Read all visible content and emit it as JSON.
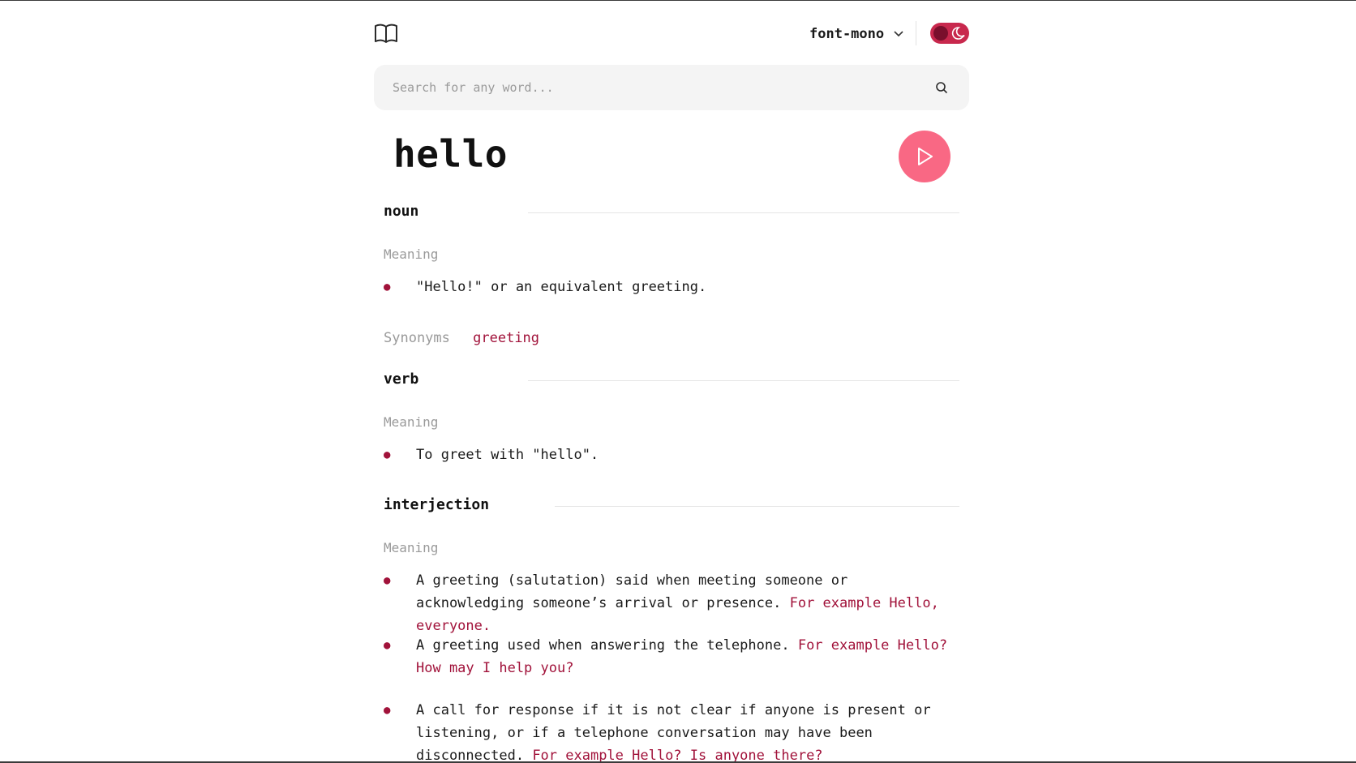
{
  "header": {
    "font_label": "font-mono",
    "logo_icon": "book-icon",
    "dropdown_icon": "chevron-down-icon",
    "theme_icon": "moon-icon",
    "accent": "#c8284d"
  },
  "search": {
    "placeholder": "Search for any word...",
    "value": ""
  },
  "entry": {
    "word": "hello",
    "play_icon": "play-icon",
    "play_color": "#f96884"
  },
  "meanings": [
    {
      "part_of_speech": "noun",
      "meaning_label": "Meaning",
      "definitions": [
        {
          "text": "\"Hello!\" or an equivalent greeting.",
          "example": ""
        }
      ],
      "synonyms_label": "Synonyms",
      "synonyms": [
        "greeting"
      ]
    },
    {
      "part_of_speech": "verb",
      "meaning_label": "Meaning",
      "definitions": [
        {
          "text": "To greet with \"hello\".",
          "example": ""
        }
      ]
    },
    {
      "part_of_speech": "interjection",
      "meaning_label": "Meaning",
      "definitions": [
        {
          "text": "A greeting (salutation) said when meeting someone or acknowledging someone’s arrival or presence.",
          "example": "For example Hello, everyone."
        },
        {
          "text": "A greeting used when answering the telephone.",
          "example": "For example Hello? How may I help you?"
        },
        {
          "text": "A call for response if it is not clear if anyone is present or listening, or if a telephone conversation may have been disconnected.",
          "example": "For example Hello? Is anyone there?"
        }
      ]
    }
  ]
}
